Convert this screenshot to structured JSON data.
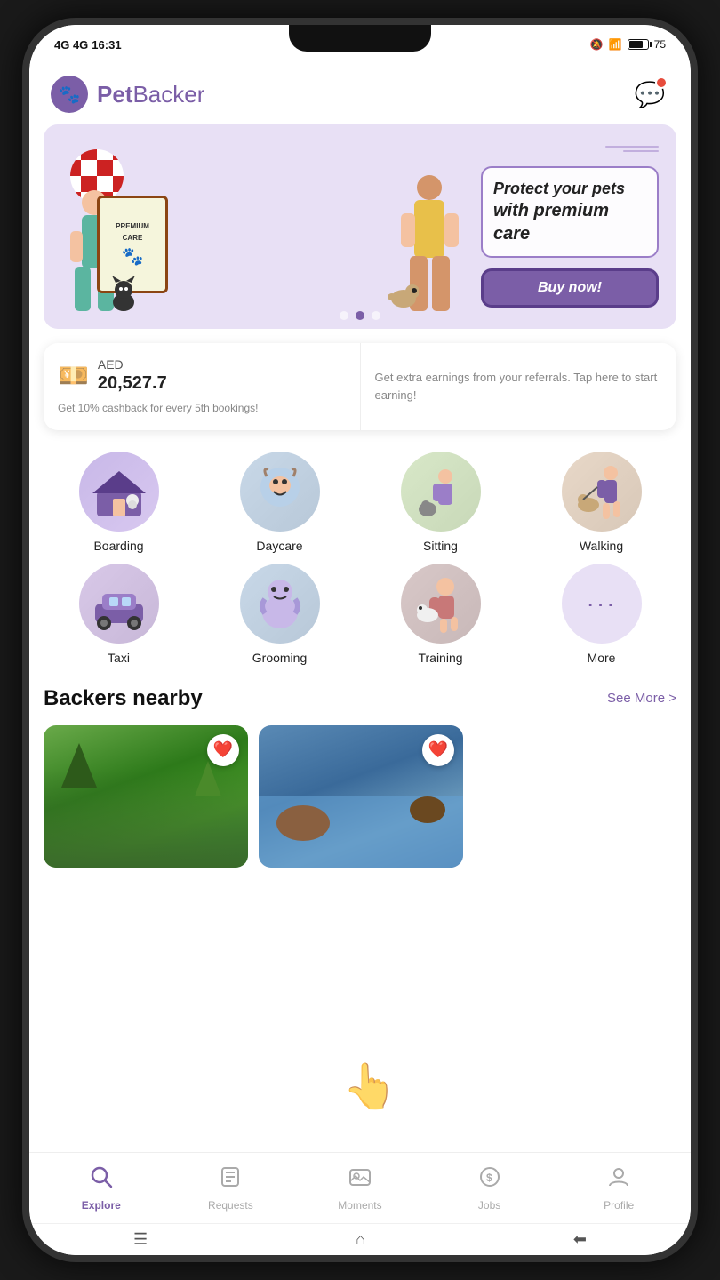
{
  "status": {
    "carrier": "4G 4G",
    "time": "16:31",
    "battery": "75"
  },
  "header": {
    "logo_text_bold": "Pet",
    "logo_text_normal": "Backer",
    "logo_emoji": "🐾"
  },
  "banner": {
    "title_line1": "Protect your pets",
    "title_line2": "with premium care",
    "button_label": "Buy now!",
    "clipboard_line1": "PREMIUM",
    "clipboard_line2": "CARE"
  },
  "earnings": {
    "currency_label": "AED",
    "amount": "20,527.7",
    "sub_text": "Get 10% cashback for every 5th bookings!",
    "cta_text": "Get extra earnings from your referrals. Tap here to start earning!"
  },
  "services": [
    {
      "id": "boarding",
      "label": "Boarding",
      "emoji": "🏠",
      "circle_class": "boarding-circle"
    },
    {
      "id": "daycare",
      "label": "Daycare",
      "emoji": "🐕",
      "circle_class": "daycare-circle"
    },
    {
      "id": "sitting",
      "label": "Sitting",
      "emoji": "🐈",
      "circle_class": "sitting-circle"
    },
    {
      "id": "walking",
      "label": "Walking",
      "emoji": "🦮",
      "circle_class": "walking-circle"
    },
    {
      "id": "taxi",
      "label": "Taxi",
      "emoji": "🚗",
      "circle_class": "taxi-circle"
    },
    {
      "id": "grooming",
      "label": "Grooming",
      "emoji": "✂️",
      "circle_class": "grooming-circle"
    },
    {
      "id": "training",
      "label": "Training",
      "emoji": "🦴",
      "circle_class": "training-circle"
    },
    {
      "id": "more",
      "label": "More",
      "emoji": "···",
      "circle_class": "more-circle"
    }
  ],
  "backers": {
    "section_title": "Backers nearby",
    "see_more_label": "See More >",
    "cards": [
      {
        "id": "card1",
        "bg_class": "green"
      },
      {
        "id": "card2",
        "bg_class": "blue"
      }
    ]
  },
  "bottom_nav": {
    "items": [
      {
        "id": "explore",
        "label": "Explore",
        "icon": "🔍",
        "active": true
      },
      {
        "id": "requests",
        "label": "Requests",
        "icon": "📋",
        "active": false
      },
      {
        "id": "moments",
        "label": "Moments",
        "icon": "🖼️",
        "active": false
      },
      {
        "id": "jobs",
        "label": "Jobs",
        "icon": "💲",
        "active": false
      },
      {
        "id": "profile",
        "label": "Profile",
        "icon": "👤",
        "active": false
      }
    ]
  },
  "system_bar": {
    "menu_icon": "☰",
    "home_icon": "⌂",
    "back_icon": "⬅"
  }
}
